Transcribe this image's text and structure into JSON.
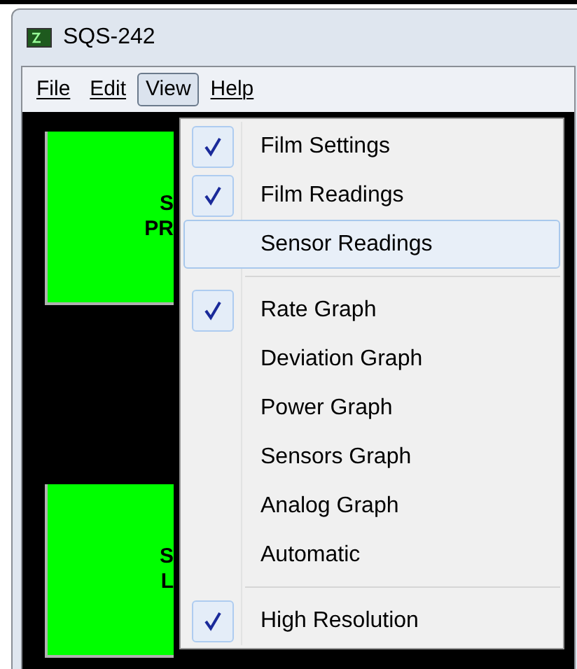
{
  "window": {
    "title": "SQS-242"
  },
  "menu_bar": [
    {
      "label": "File",
      "selected": false
    },
    {
      "label": "Edit",
      "selected": false
    },
    {
      "label": "View",
      "selected": true
    },
    {
      "label": "Help",
      "selected": false
    }
  ],
  "panels": [
    {
      "lines": [
        "S",
        "PR"
      ]
    },
    {
      "lines": [
        "S",
        "L"
      ]
    }
  ],
  "view_menu": [
    {
      "kind": "item",
      "label": "Film Settings",
      "checked": true,
      "selected": false
    },
    {
      "kind": "item",
      "label": "Film Readings",
      "checked": true,
      "selected": false
    },
    {
      "kind": "item",
      "label": "Sensor Readings",
      "checked": false,
      "selected": true
    },
    {
      "kind": "separator"
    },
    {
      "kind": "item",
      "label": "Rate Graph",
      "checked": true,
      "selected": false
    },
    {
      "kind": "item",
      "label": "Deviation Graph",
      "checked": false,
      "selected": false
    },
    {
      "kind": "item",
      "label": "Power Graph",
      "checked": false,
      "selected": false
    },
    {
      "kind": "item",
      "label": "Sensors Graph",
      "checked": false,
      "selected": false
    },
    {
      "kind": "item",
      "label": "Analog Graph",
      "checked": false,
      "selected": false
    },
    {
      "kind": "item",
      "label": "Automatic",
      "checked": false,
      "selected": false
    },
    {
      "kind": "separator"
    },
    {
      "kind": "item",
      "label": "High Resolution",
      "checked": true,
      "selected": false
    }
  ]
}
